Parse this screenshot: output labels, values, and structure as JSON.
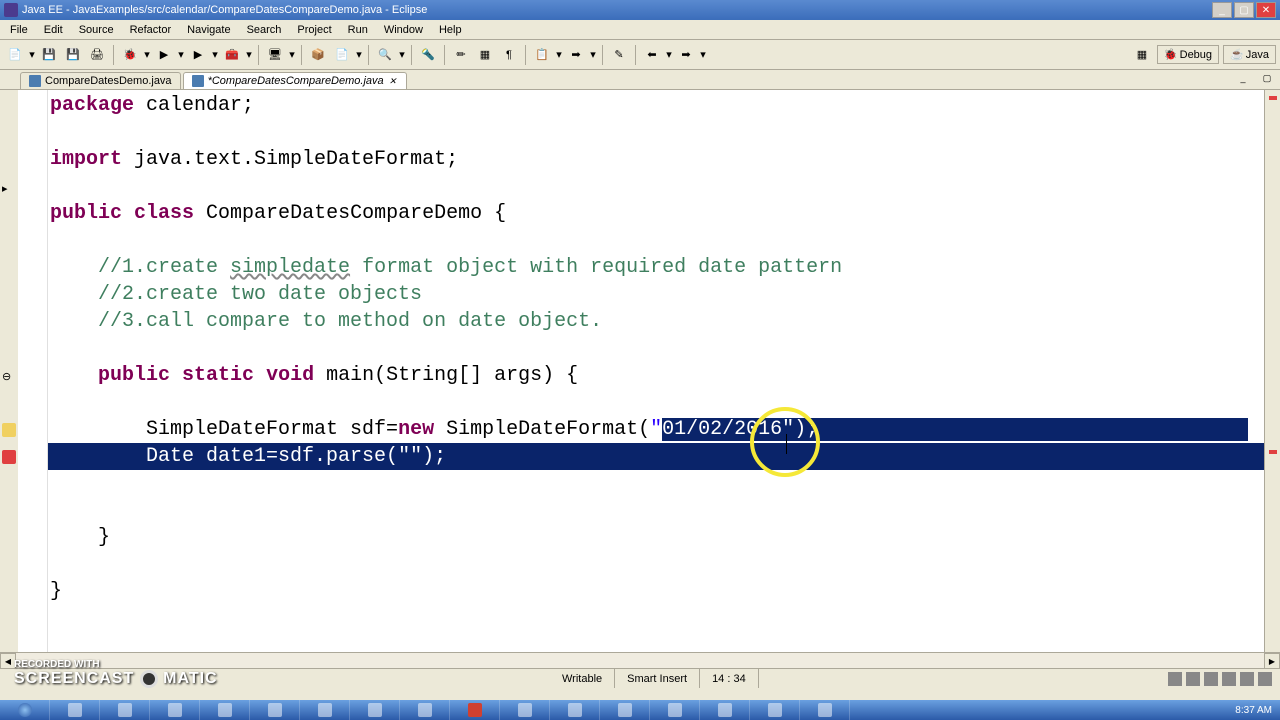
{
  "window": {
    "title": "Java EE - JavaExamples/src/calendar/CompareDatesCompareDemo.java - Eclipse"
  },
  "menu": {
    "file": "File",
    "edit": "Edit",
    "source": "Source",
    "refactor": "Refactor",
    "navigate": "Navigate",
    "search": "Search",
    "project": "Project",
    "run": "Run",
    "window": "Window",
    "help": "Help"
  },
  "toolbar": {
    "debug_label": "Debug",
    "java_label": "Java"
  },
  "tabs": {
    "tab1": "CompareDatesDemo.java",
    "tab2": "*CompareDatesCompareDemo.java"
  },
  "code": {
    "l1_kw": "package",
    "l1_rest": " calendar;",
    "l2_kw": "import",
    "l2_rest": " java.text.SimpleDateFormat;",
    "l3_a": "public",
    "l3_b": "class",
    "l3_rest": " CompareDatesCompareDemo {",
    "l4": "    //1.create ",
    "l4_u": "simpledate",
    "l4_rest": " format object with required date pattern",
    "l5": "    //2.create two date objects",
    "l6": "    //3.call compare to method on date object.",
    "l7_a": "public",
    "l7_b": "static",
    "l7_c": "void",
    "l7_rest": " main(String[] args) {",
    "l8_pre": "        SimpleDateFormat sdf=",
    "l8_new": "new",
    "l8_mid": " SimpleDateFormat(",
    "l8_str_a": "\"",
    "l8_str_sel": "01/02/2016",
    "l8_str_b": "\"",
    "l8_end": ");",
    "l9_pre": "        Date date1=sdf.parse(",
    "l9_str": "\"\"",
    "l9_end": ");",
    "l10": "    }",
    "l11": "}"
  },
  "status": {
    "writable": "Writable",
    "insert": "Smart Insert",
    "position": "14 : 34"
  },
  "watermark": {
    "top": "RECORDED WITH",
    "brand_a": "SCREENCAST",
    "brand_b": "MATIC"
  },
  "taskbar": {
    "time": "8:37 AM"
  }
}
